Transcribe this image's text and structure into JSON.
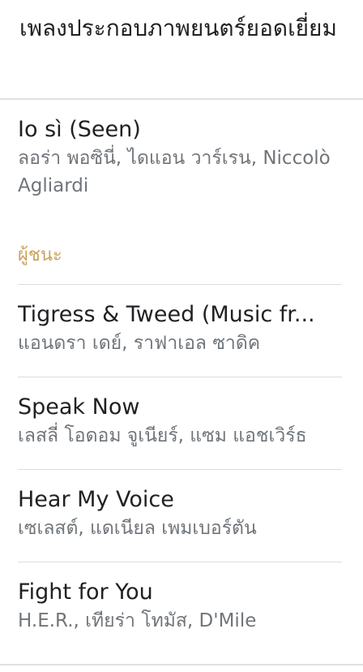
{
  "section": {
    "heading": "เพลงประกอบภาพยนตร์ยอดเยี่ยม"
  },
  "nominees_top": [
    {
      "title": "Io sì (Seen)",
      "artists": "ลอร่า พอซินี่, ไดแอน วาร์เรน, Niccolò Agliardi"
    }
  ],
  "winner_label": "ผู้ชนะ",
  "nominees": [
    {
      "title": "Tigress & Tweed (Music fr...",
      "artists": "แอนดรา เดย์, ราฟาเอล ซาดิค"
    },
    {
      "title": "Speak Now",
      "artists": "เลสลี่ โอดอม จูเนียร์, แซม แอชเวิร์ธ"
    },
    {
      "title": "Hear My Voice",
      "artists": "เซเลสต์, แดเนียล เพมเบอร์ตัน"
    },
    {
      "title": "Fight for You",
      "artists": "H.E.R., เทียร่า โทมัส, D'Mile"
    }
  ],
  "colors": {
    "accent_winner": "#c9a15a",
    "text_primary": "#202124",
    "text_secondary": "#70757a",
    "divider": "#dadce0"
  }
}
